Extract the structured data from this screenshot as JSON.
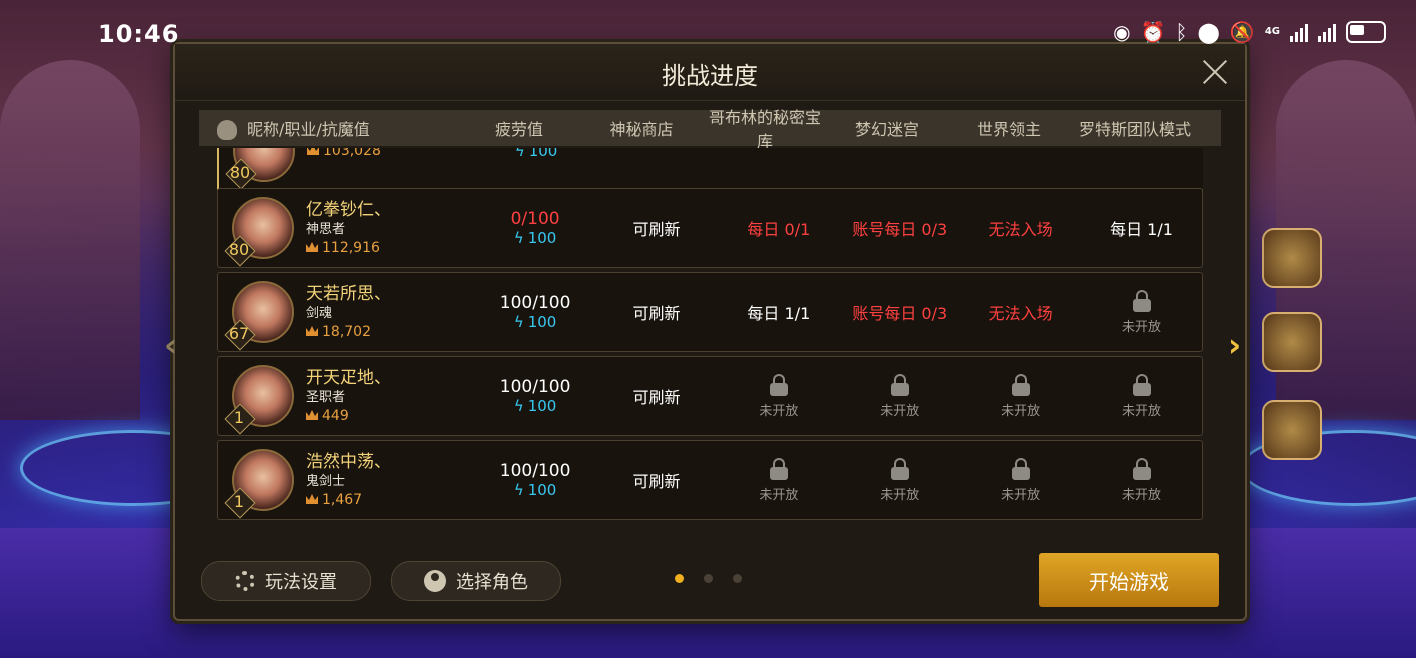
{
  "status_bar": {
    "time": "10:46",
    "network": "4G"
  },
  "dialog": {
    "title": "挑战进度",
    "columns": [
      "昵称/职业/抗魔值",
      "疲劳值",
      "神秘商店",
      "哥布林的秘密宝库",
      "梦幻迷宫",
      "世界领主",
      "罗特斯团队模式"
    ],
    "rows": [
      {
        "level": "80",
        "name": "",
        "job": "",
        "power": "103,028",
        "selected": true,
        "fatigue": "",
        "energy": "100",
        "shop": "",
        "cells": [
          {
            "locked": false,
            "text": "",
            "color": "white"
          },
          {
            "locked": false,
            "text": "",
            "color": "white"
          },
          {
            "locked": false,
            "text": "",
            "color": "white"
          },
          {
            "locked": false,
            "text": "",
            "color": "white"
          }
        ]
      },
      {
        "level": "80",
        "name": "亿拳钞仁、",
        "job": "神思者",
        "power": "112,916",
        "selected": false,
        "fatigue": "0/100",
        "fatigue_red": true,
        "energy": "100",
        "shop": "可刷新",
        "cells": [
          {
            "locked": false,
            "text": "每日 0/1",
            "color": "red"
          },
          {
            "locked": false,
            "text": "账号每日 0/3",
            "color": "red"
          },
          {
            "locked": false,
            "text": "无法入场",
            "color": "red"
          },
          {
            "locked": false,
            "text": "每日 1/1",
            "color": "white"
          }
        ]
      },
      {
        "level": "67",
        "name": "天若所思、",
        "job": "剑魂",
        "power": "18,702",
        "selected": false,
        "fatigue": "100/100",
        "fatigue_red": false,
        "energy": "100",
        "shop": "可刷新",
        "cells": [
          {
            "locked": false,
            "text": "每日 1/1",
            "color": "white"
          },
          {
            "locked": false,
            "text": "账号每日 0/3",
            "color": "red"
          },
          {
            "locked": false,
            "text": "无法入场",
            "color": "red"
          },
          {
            "locked": true,
            "text": "未开放",
            "color": "gray"
          }
        ]
      },
      {
        "level": "1",
        "name": "开天疋地、",
        "job": "圣职者",
        "power": "449",
        "selected": false,
        "fatigue": "100/100",
        "fatigue_red": false,
        "energy": "100",
        "shop": "可刷新",
        "cells": [
          {
            "locked": true,
            "text": "未开放",
            "color": "gray"
          },
          {
            "locked": true,
            "text": "未开放",
            "color": "gray"
          },
          {
            "locked": true,
            "text": "未开放",
            "color": "gray"
          },
          {
            "locked": true,
            "text": "未开放",
            "color": "gray"
          }
        ]
      },
      {
        "level": "1",
        "name": "浩然中荡、",
        "job": "鬼剑士",
        "power": "1,467",
        "selected": false,
        "fatigue": "100/100",
        "fatigue_red": false,
        "energy": "100",
        "shop": "可刷新",
        "cells": [
          {
            "locked": true,
            "text": "未开放",
            "color": "gray"
          },
          {
            "locked": true,
            "text": "未开放",
            "color": "gray"
          },
          {
            "locked": true,
            "text": "未开放",
            "color": "gray"
          },
          {
            "locked": true,
            "text": "未开放",
            "color": "gray"
          }
        ]
      }
    ],
    "footer": {
      "settings_label": "玩法设置",
      "select_role_label": "选择角色",
      "start_label": "开始游戏",
      "page_count": 3,
      "active_page": 1
    }
  },
  "colors": {
    "accent": "#e0a526",
    "name": "#f3d37a",
    "red": "#ff4040",
    "energy": "#38c8f0"
  }
}
